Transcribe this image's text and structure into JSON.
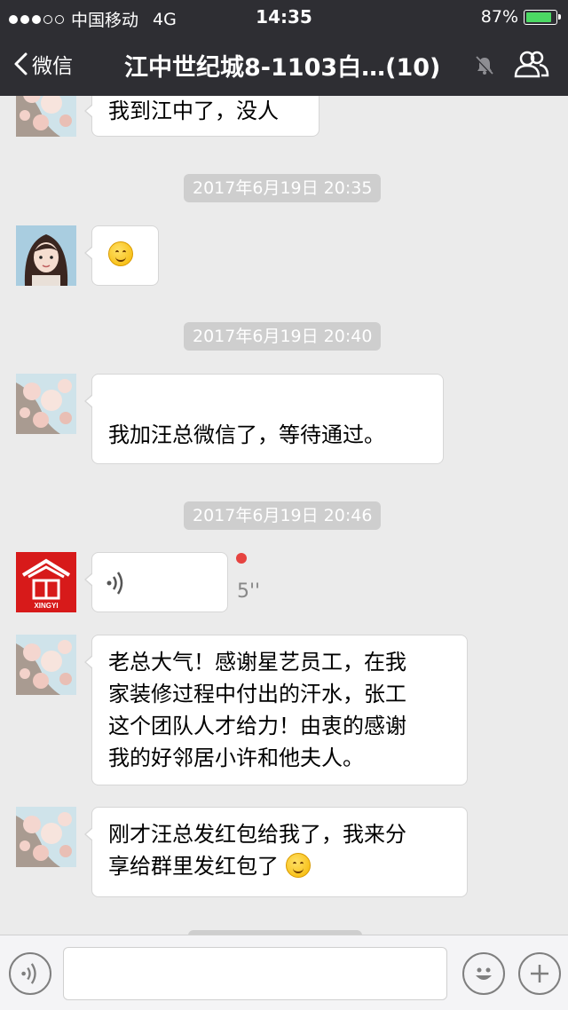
{
  "status_bar": {
    "carrier": "中国移动",
    "network": "4G",
    "time": "14:35",
    "battery": "87%",
    "battery_level": 0.87,
    "signal_bars": 3
  },
  "nav": {
    "back_label": "微信",
    "title": "江中世纪城8-1103白…(10)"
  },
  "messages": [
    {
      "type": "text",
      "avatar": "flower-avatar",
      "text": "我到江中了，没人"
    },
    {
      "type": "timestamp",
      "text": "2017年6月19日 20:35"
    },
    {
      "type": "emoji",
      "avatar": "girl-avatar"
    },
    {
      "type": "timestamp",
      "text": "2017年6月19日 20:40"
    },
    {
      "type": "text",
      "avatar": "flower-avatar",
      "text": "我加汪总微信了，等待通过。"
    },
    {
      "type": "timestamp",
      "text": "2017年6月19日 20:46"
    },
    {
      "type": "voice",
      "avatar": "xingyi-logo-avatar",
      "logo_text": "XINGYI",
      "duration": "5''",
      "unread": true
    },
    {
      "type": "text",
      "avatar": "flower-avatar",
      "lines": [
        "老总大气！感谢星艺员工，在我",
        "家装修过程中付出的汗水，张工",
        "这个团队人才给力！由衷的感谢",
        "我的好邻居小许和他夫人。"
      ]
    },
    {
      "type": "text",
      "avatar": "flower-avatar",
      "lines": [
        "刚才汪总发红包给我了，我来分",
        "享给群里发红包了"
      ],
      "trailing_emoji": true
    }
  ],
  "input_bar": {
    "voice_icon": "voice-input-icon",
    "emoji_icon": "emoji-icon",
    "plus_icon": "plus-icon",
    "input_value": ""
  },
  "colors": {
    "header_bg": "#2e2e33",
    "chat_bg": "#ebebeb",
    "bubble_bg": "#ffffff",
    "timestamp_bg": "#cecece",
    "battery_fill": "#4cd964",
    "unread_dot": "#e64340"
  }
}
